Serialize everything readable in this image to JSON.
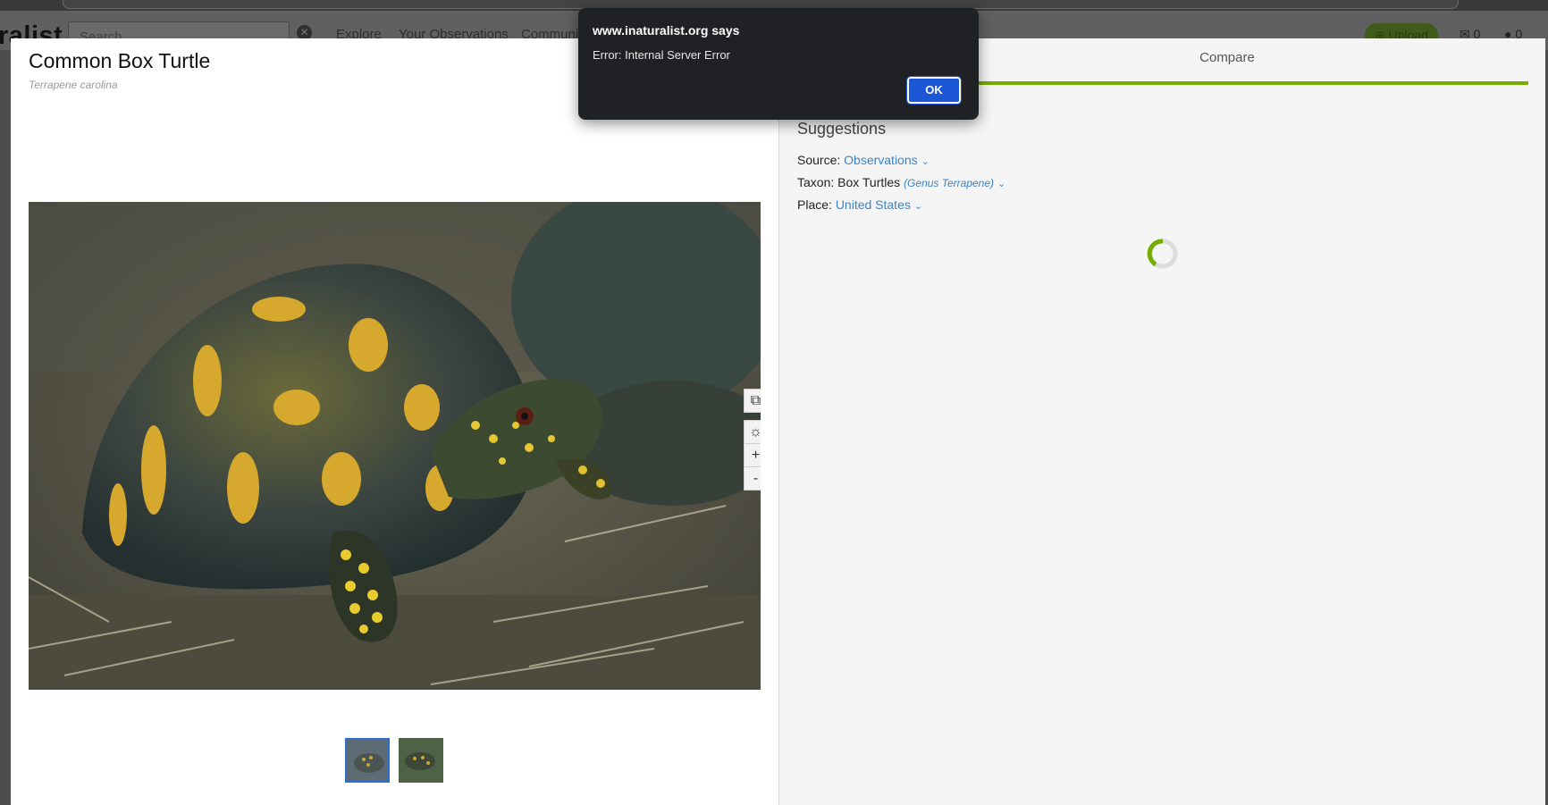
{
  "app": {
    "logo_text": "ralist",
    "search_placeholder": "Search",
    "nav": [
      "Explore",
      "Your Observations",
      "Community"
    ],
    "upload_label": "Upload",
    "messages_count": "0",
    "notifications_count": "0"
  },
  "modal": {
    "title": "Common Box Turtle",
    "scientific_name": "Terrapene carolina",
    "compare_tab": "Compare",
    "suggestions_heading": "Suggestions",
    "filters": {
      "source_label": "Source:",
      "source_value": "Observations",
      "taxon_label": "Taxon:",
      "taxon_value": "Box Turtles",
      "taxon_rank": "(Genus",
      "taxon_genus": "Terrapene",
      "taxon_rank_close": ")",
      "place_label": "Place:",
      "place_value": "United States"
    },
    "photo_controls": {
      "plus": "+",
      "minus": "-"
    },
    "thumbnail_count": 2,
    "selected_thumbnail": 1
  },
  "dialog": {
    "title": "www.inaturalist.org says",
    "message": "Error: Internal Server Error",
    "ok_label": "OK"
  },
  "colors": {
    "accent_green": "#74ac00",
    "link_blue": "#3b83c7",
    "dialog_bg": "#202124",
    "ok_blue": "#1a56d6"
  }
}
